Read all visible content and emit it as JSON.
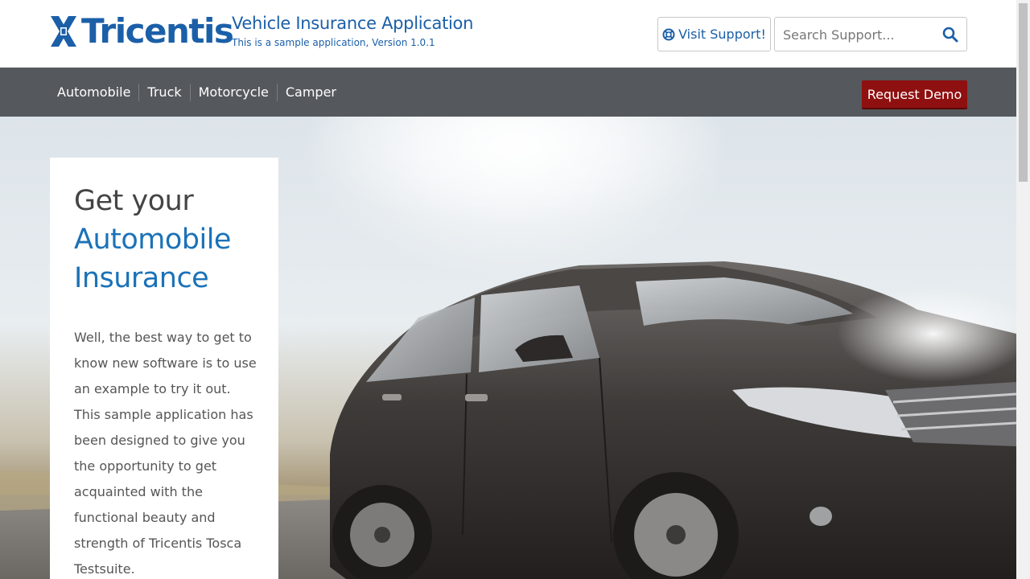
{
  "header": {
    "logo_text": "Tricentis",
    "app_title": "Vehicle Insurance Application",
    "app_subtitle": "This is a sample application, Version 1.0.1",
    "support_label": "Visit Support!",
    "search_placeholder": "Search Support..."
  },
  "nav": {
    "items": [
      {
        "label": "Automobile"
      },
      {
        "label": "Truck"
      },
      {
        "label": "Motorcycle"
      },
      {
        "label": "Camper"
      }
    ],
    "demo_label": "Request Demo"
  },
  "hero": {
    "headline_prefix": "Get your",
    "headline_line2": "Automobile",
    "headline_line3": "Insurance",
    "intro": "Well, the best way to get to know new software is to use an example to try it out. This sample application has been designed to give you the opportunity to get acquainted with the functional beauty and strength of Tricentis Tosca Testsuite."
  },
  "icons": [
    "tricentis-logo-icon",
    "lifebuoy-icon",
    "search-icon"
  ],
  "colors": {
    "brand_blue": "#1b5fa8",
    "nav_bg": "#55585c",
    "demo_button": "#8f1010"
  }
}
